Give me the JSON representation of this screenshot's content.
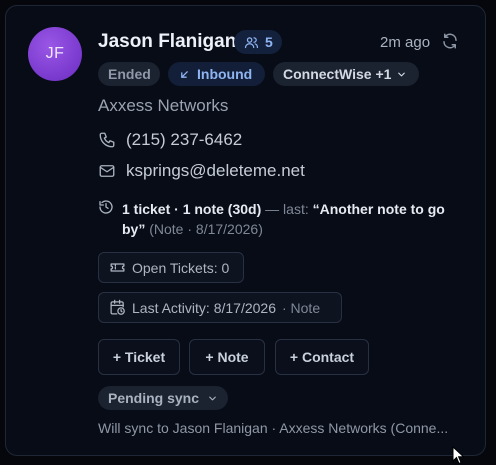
{
  "contact": {
    "initials": "JF",
    "name": "Jason Flanigan",
    "group_count": "5",
    "time_ago": "2m ago",
    "company": "Axxess Networks",
    "phone": "(215) 237-6462",
    "email": "ksprings@deleteme.net"
  },
  "tags": {
    "status": "Ended",
    "direction": "Inbound",
    "integration": "ConnectWise +1"
  },
  "activity": {
    "summary": "1 ticket · 1 note (30d)",
    "last_prefix": "— last:",
    "last_quote": "“Another note to go by”",
    "meta": "(Note · 8/17/2026)"
  },
  "chips": {
    "open_tickets": "Open Tickets: 0",
    "last_activity": "Last Activity: 8/17/2026",
    "last_activity_type": "· Note"
  },
  "actions": {
    "ticket": "+ Ticket",
    "note": "+ Note",
    "contact": "+ Contact"
  },
  "sync": {
    "status": "Pending sync",
    "description": "Will sync to Jason Flanigan · Axxess Networks (Conne..."
  },
  "icons": {
    "group": "users-icon",
    "refresh": "refresh-icon",
    "inbound": "arrow-down-left-icon",
    "chevron": "chevron-down-icon",
    "phone": "phone-icon",
    "email": "mail-icon",
    "history": "history-icon",
    "ticket": "ticket-icon",
    "calendar": "calendar-clock-icon"
  },
  "colors": {
    "background": "#05070d",
    "card": "#080c17",
    "accent_blue": "#8fb4f2",
    "avatar_purple": "#7b3bd6"
  }
}
